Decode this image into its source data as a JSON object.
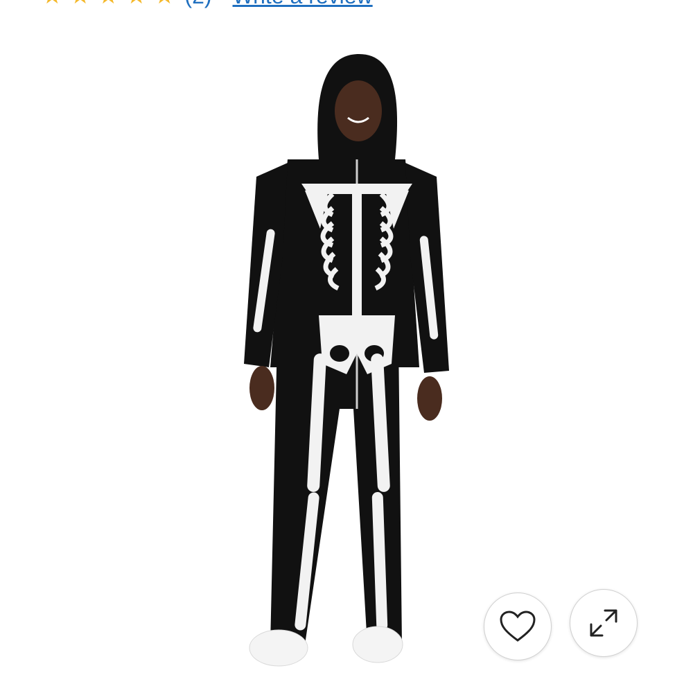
{
  "rating": {
    "star_icon": "star-icon",
    "star_count": 5,
    "star_color": "#f4b82a",
    "count_text": "(2)",
    "review_link": "Write a review",
    "link_color": "#1f6fbf"
  },
  "product": {
    "image_icon": "skeleton-costume-photo"
  },
  "actions": {
    "favorite_icon": "heart-icon",
    "expand_icon": "expand-icon"
  }
}
